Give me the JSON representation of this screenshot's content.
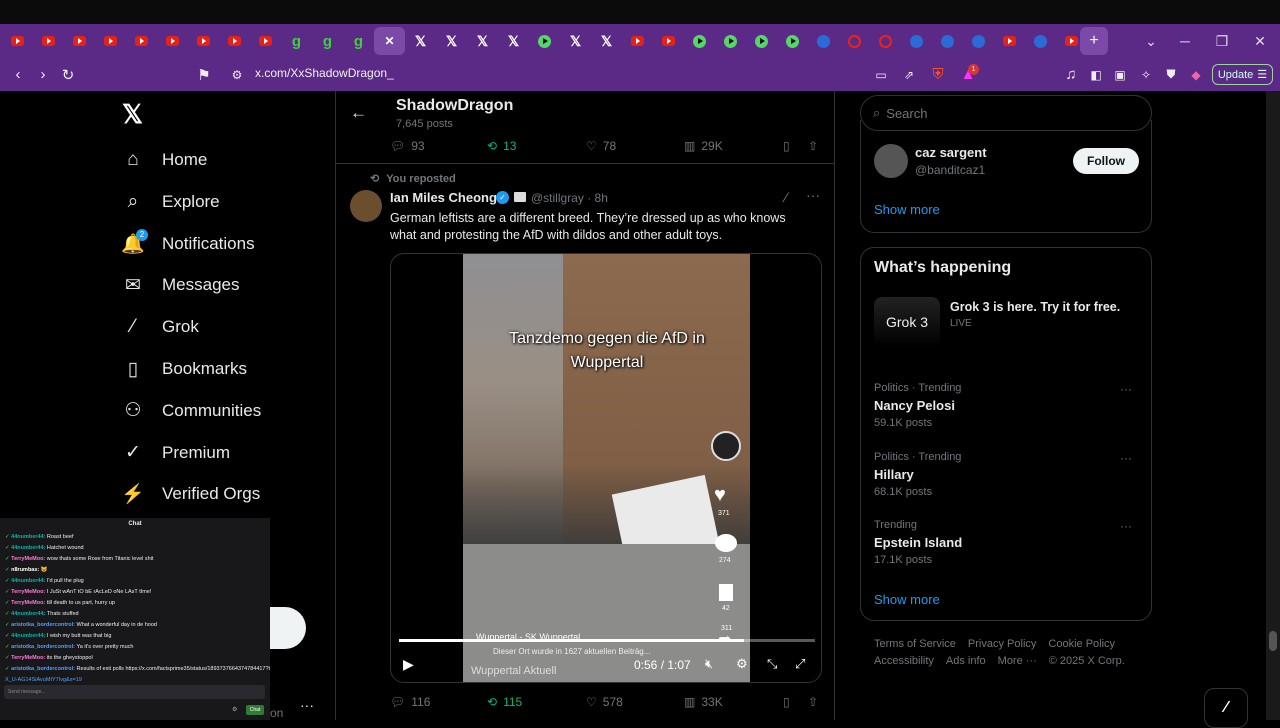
{
  "browser": {
    "tabs": [
      {
        "icon": "yt"
      },
      {
        "icon": "yt"
      },
      {
        "icon": "yt"
      },
      {
        "icon": "yt"
      },
      {
        "icon": "yt"
      },
      {
        "icon": "yt"
      },
      {
        "icon": "yt"
      },
      {
        "icon": "yt"
      },
      {
        "icon": "yt"
      },
      {
        "icon": "g"
      },
      {
        "icon": "g"
      },
      {
        "icon": "g"
      },
      {
        "icon": "active"
      },
      {
        "icon": "x"
      },
      {
        "icon": "x"
      },
      {
        "icon": "x"
      },
      {
        "icon": "x"
      },
      {
        "icon": "play"
      },
      {
        "icon": "x"
      },
      {
        "icon": "x"
      },
      {
        "icon": "yt"
      },
      {
        "icon": "yt"
      },
      {
        "icon": "play"
      },
      {
        "icon": "play"
      },
      {
        "icon": "play"
      },
      {
        "icon": "play"
      },
      {
        "icon": "blue"
      },
      {
        "icon": "red"
      },
      {
        "icon": "red"
      },
      {
        "icon": "blue"
      },
      {
        "icon": "blue"
      },
      {
        "icon": "blue"
      },
      {
        "icon": "yt"
      },
      {
        "icon": "blue"
      },
      {
        "icon": "yt"
      }
    ],
    "new_tab_glyph": "+",
    "url": "x.com/XxShadowDragon_",
    "update_label": "Update",
    "notification_count": "1",
    "accent": "#5b2a86"
  },
  "sidebar": {
    "logo": "𝕏",
    "items": [
      {
        "label": "Home",
        "icon": "⌂"
      },
      {
        "label": "Explore",
        "icon": "⌕"
      },
      {
        "label": "Notifications",
        "icon": "🔔",
        "badge": "2"
      },
      {
        "label": "Messages",
        "icon": "✉"
      },
      {
        "label": "Grok",
        "icon": "⁄"
      },
      {
        "label": "Bookmarks",
        "icon": "▯"
      },
      {
        "label": "Communities",
        "icon": "⚇"
      },
      {
        "label": "Premium",
        "icon": "✓"
      },
      {
        "label": "Verified Orgs",
        "icon": "⚡"
      }
    ],
    "more_dots": "···",
    "partial_text": "on"
  },
  "header": {
    "title": "ShadowDragon",
    "posts": "7,645 posts"
  },
  "prev_tweet_actions": {
    "replies": "93",
    "reposts": "13",
    "likes": "78",
    "views": "29K"
  },
  "tweet": {
    "repost_note": "You reposted",
    "author": "Ian Miles Cheong",
    "handle": "@stillgray",
    "time": "8h",
    "text": "German leftists are a different breed. They’re dressed up as who knows what and protesting the AfD with dildos and other adult toys.",
    "video": {
      "caption": "Tanzdemo gegen die AfD in Wuppertal",
      "like_count": "371",
      "comment_count": "274",
      "save_count": "42",
      "share_count": "311",
      "account_line": "Wuppertal - SK Wuppertal",
      "sub_line": "Dieser Ort wurde in 1627 aktuellen Beiträg...",
      "watermark": "Wuppertal Aktuell",
      "time": "0:56 / 1:07",
      "progress": 0.83
    },
    "actions": {
      "replies": "116",
      "reposts": "115",
      "likes": "578",
      "views": "33K"
    }
  },
  "right": {
    "search_placeholder": "Search",
    "follow_suggestion": {
      "name": "caz sargent",
      "handle": "@banditcaz1",
      "button": "Follow"
    },
    "show_more": "Show more",
    "whats_happening_title": "What’s happening",
    "grok_promo": {
      "title": "Grok 3 is here. Try it for free.",
      "status": "LIVE",
      "image_text": "Grok 3"
    },
    "trends": [
      {
        "category": "Politics · Trending",
        "name": "Nancy Pelosi",
        "count": "59.1K posts"
      },
      {
        "category": "Politics · Trending",
        "name": "Hillary",
        "count": "68.1K posts"
      },
      {
        "category": "Trending",
        "name": "Epstein Island",
        "count": "17.1K posts"
      }
    ],
    "show_more_2": "Show more",
    "footer_links": [
      "Terms of Service",
      "Privacy Policy",
      "Cookie Policy",
      "Accessibility",
      "Ads info",
      "More ···",
      "© 2025 X Corp."
    ]
  },
  "chat": {
    "title": "Chat",
    "lines": [
      {
        "user": "44number44",
        "msg": "Roast beef",
        "color": "#00b5ad"
      },
      {
        "user": "44number44",
        "msg": "Hatchet wound",
        "color": "#00b5ad"
      },
      {
        "user": "TerryMeMoo",
        "msg": "wow thats some Rose from Titanic level shit",
        "color": "#ff7ad9"
      },
      {
        "user": "n8rumbas",
        "msg": "😺",
        "color": "#ffffff"
      },
      {
        "user": "44number44",
        "msg": "I'd pull the plug",
        "color": "#00b5ad"
      },
      {
        "user": "TerryMeMoo",
        "msg": "I JuSt wAnT tO bE rAcLeD oNe LAsT tIme!",
        "color": "#ff7ad9"
      },
      {
        "user": "TerryMeMoo",
        "msg": "till death to us part, hurry up",
        "color": "#ff7ad9"
      },
      {
        "user": "44number44",
        "msg": "Thats stuffed",
        "color": "#00b5ad"
      },
      {
        "user": "aristotka_bordercontrol",
        "msg": "What a wonderful day in de hood",
        "color": "#4fa3ff"
      },
      {
        "user": "44number44",
        "msg": "I wish my butt was that big",
        "color": "#00b5ad"
      },
      {
        "user": "aristotka_bordercontrol",
        "msg": "Ya it's over pretty much",
        "color": "#4fa3ff"
      },
      {
        "user": "TerryMeMoo",
        "msg": "its the gheystoppol",
        "color": "#ff7ad9"
      },
      {
        "user": "aristotka_bordercontrol",
        "msg": "Results of exit polls https://x.com/factsprime35/status/1893737664374784417?t=Qu",
        "color": "#4fa3ff"
      }
    ],
    "overflow_line": "X_U-AG14SiAvuMtY7Ivg&s=19",
    "input_placeholder": "Send message...",
    "send_label": "Chat"
  }
}
